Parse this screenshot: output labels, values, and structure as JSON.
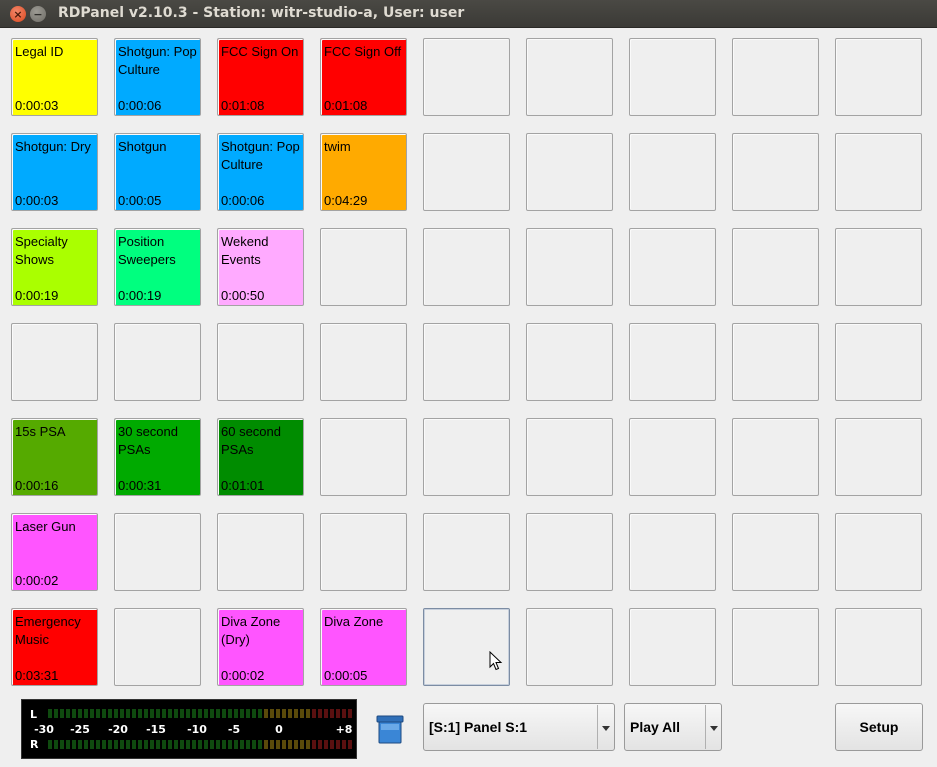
{
  "window": {
    "title": "RDPanel v2.10.3 - Station: witr-studio-a, User: user"
  },
  "grid": {
    "rows": [
      [
        {
          "label": "Legal ID",
          "length": "0:00:03",
          "color": "#ffff00",
          "text_color": "#000000"
        },
        {
          "label": "Shotgun: Pop Culture",
          "length": "0:00:06",
          "color": "#00aaff",
          "text_color": "#000000"
        },
        {
          "label": "FCC Sign On",
          "length": "0:01:08",
          "color": "#ff0000",
          "text_color": "#000000"
        },
        {
          "label": "FCC Sign Off",
          "length": "0:01:08",
          "color": "#ff0000",
          "text_color": "#000000"
        },
        {},
        {},
        {},
        {},
        {}
      ],
      [
        {
          "label": "Shotgun: Dry",
          "length": "0:00:03",
          "color": "#00aaff",
          "text_color": "#000000"
        },
        {
          "label": "Shotgun",
          "length": "0:00:05",
          "color": "#00aaff",
          "text_color": "#000000"
        },
        {
          "label": "Shotgun: Pop Culture",
          "length": "0:00:06",
          "color": "#00aaff",
          "text_color": "#000000"
        },
        {
          "label": "twim",
          "length": "0:04:29",
          "color": "#ffaa00",
          "text_color": "#000000"
        },
        {},
        {},
        {},
        {},
        {}
      ],
      [
        {
          "label": "Specialty Shows",
          "length": "0:00:19",
          "color": "#aaff00",
          "text_color": "#000000"
        },
        {
          "label": "Position Sweepers",
          "length": "0:00:19",
          "color": "#00ff7f",
          "text_color": "#000000"
        },
        {
          "label": "Wekend Events",
          "length": "0:00:50",
          "color": "#ffaaff",
          "text_color": "#000000"
        },
        {},
        {},
        {},
        {},
        {},
        {}
      ],
      [
        {},
        {},
        {},
        {},
        {},
        {},
        {},
        {},
        {}
      ],
      [
        {
          "label": "15s PSA",
          "length": "0:00:16",
          "color": "#55aa00",
          "text_color": "#000000"
        },
        {
          "label": "30 second PSAs",
          "length": "0:00:31",
          "color": "#00aa00",
          "text_color": "#000000"
        },
        {
          "label": "60 second PSAs",
          "length": "0:01:01",
          "color": "#008c00",
          "text_color": "#000000"
        },
        {},
        {},
        {},
        {},
        {},
        {}
      ],
      [
        {
          "label": "Laser Gun",
          "length": "0:00:02",
          "color": "#ff55ff",
          "text_color": "#000000"
        },
        {},
        {},
        {},
        {},
        {},
        {},
        {},
        {}
      ],
      [
        {
          "label": "Emergency Music",
          "length": "0:03:31",
          "color": "#ff0000",
          "text_color": "#000000"
        },
        {},
        {
          "label": "Diva Zone (Dry)",
          "length": "0:00:02",
          "color": "#ff55ff",
          "text_color": "#000000"
        },
        {
          "label": "Diva Zone",
          "length": "0:00:05",
          "color": "#ff55ff",
          "text_color": "#000000"
        },
        {
          "focused": true
        },
        {},
        {},
        {},
        {}
      ]
    ]
  },
  "meter": {
    "left_label": "L",
    "right_label": "R",
    "scale": [
      "-30",
      "-25",
      "-20",
      "-15",
      "-10",
      "-5",
      "0",
      "+8"
    ]
  },
  "panel_selector": {
    "value": "[S:1] Panel S:1"
  },
  "play_all": {
    "label": "Play All"
  },
  "setup": {
    "label": "Setup"
  },
  "icons": {
    "close": "close-icon",
    "minimize": "minimize-icon",
    "trash": "trash-icon",
    "dropdown": "chevron-down-icon"
  }
}
